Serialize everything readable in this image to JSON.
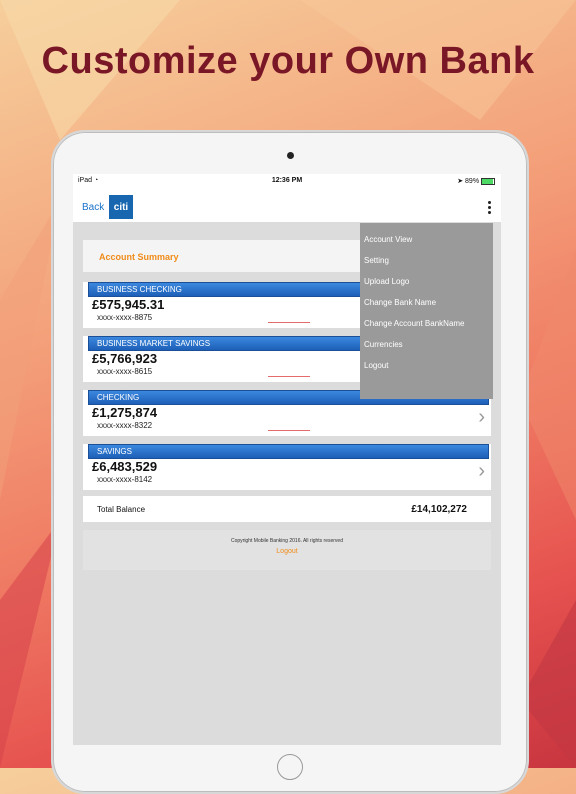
{
  "headline": "Customize your Own Bank",
  "status": {
    "device": "iPad",
    "time": "12:36 PM",
    "battery": "89%"
  },
  "nav": {
    "back_label": "Back",
    "logo_text": "citi"
  },
  "summary_label": "Account Summary",
  "accounts": [
    {
      "name": "BUSINESS CHECKING",
      "amount": "£575,945.31",
      "number": "xxxx-xxxx-8875"
    },
    {
      "name": "BUSINESS MARKET SAVINGS",
      "amount": "£5,766,923",
      "number": "xxxx-xxxx-8615"
    },
    {
      "name": "CHECKING",
      "amount": "£1,275,874",
      "number": "xxxx-xxxx-8322"
    },
    {
      "name": "SAVINGS",
      "amount": "£6,483,529",
      "number": "xxxx-xxxx-8142"
    }
  ],
  "total": {
    "label": "Total Balance",
    "value": "£14,102,272"
  },
  "footer": {
    "copyright": "Copyright Mobile Banking 2016. All rights reserved",
    "logout": "Logout"
  },
  "menu": {
    "items": [
      "Account View",
      "Setting",
      "Upload Logo",
      "Change Bank Name",
      "Change Account BankName",
      "Currencies",
      "Logout"
    ]
  },
  "colors": {
    "headline": "#7a1726",
    "accent": "#f08c1a",
    "bar": "#1d5fb8"
  }
}
